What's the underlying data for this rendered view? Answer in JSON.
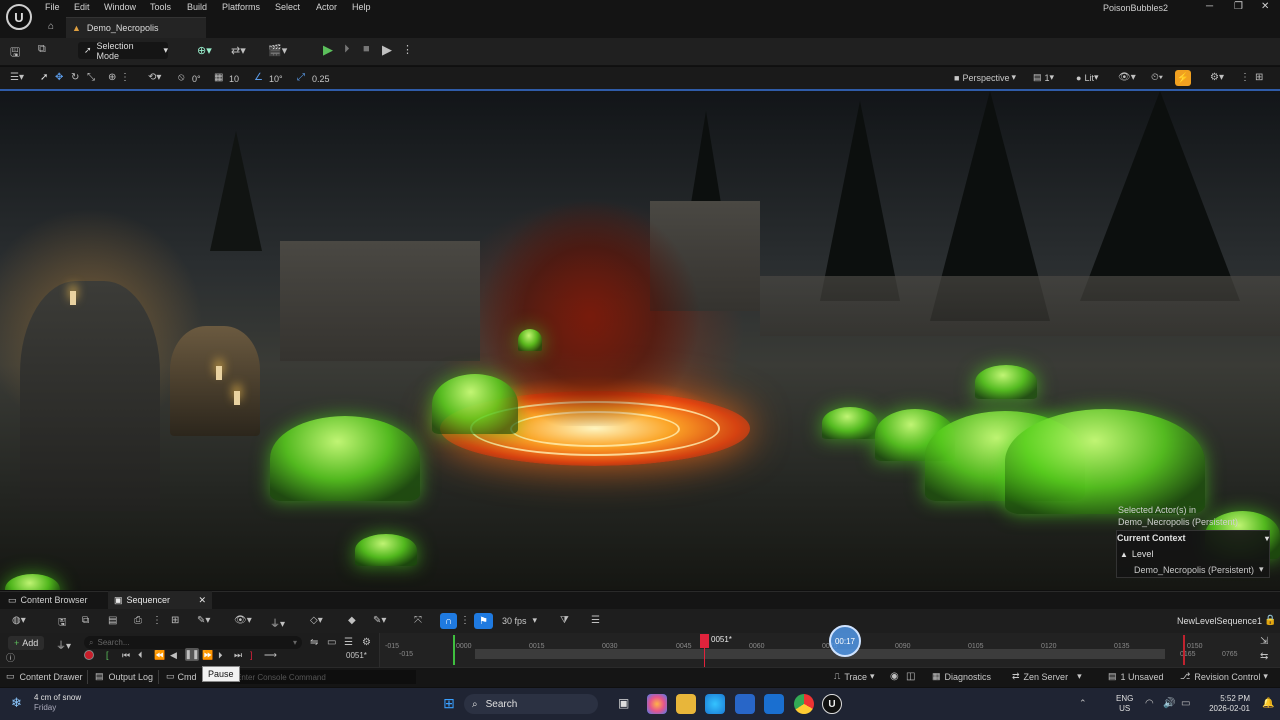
{
  "menu": {
    "items": [
      "File",
      "Edit",
      "Window",
      "Tools",
      "Build",
      "Platforms",
      "Select",
      "Actor",
      "Help"
    ],
    "project_name": "PoisonBubbles2"
  },
  "level_tab": {
    "label": "Demo_Necropolis"
  },
  "toolbar": {
    "selection_mode": "Selection Mode"
  },
  "viewport_toolbar": {
    "rotation_value": "0°",
    "grid_value": "10",
    "angle_value": "10°",
    "scale_value": "0.25",
    "view_mode": "Perspective",
    "camera_speed": "1",
    "lit_mode": "Lit"
  },
  "actor_overlay": {
    "selected_line1": "Selected Actor(s) in",
    "selected_line2": "Demo_Necropolis (Persistent)",
    "current_context": "Current Context",
    "level_label": "Level",
    "level_value": "Demo_Necropolis (Persistent)"
  },
  "panels": {
    "content_browser": "Content Browser",
    "sequencer": "Sequencer"
  },
  "sequencer": {
    "fps": "30 fps",
    "sequence_name": "NewLevelSequence1",
    "add_label": "Add",
    "search_placeholder": "Search...",
    "current_frame": "0051*",
    "playhead_frame": "0051*",
    "playhead_time": "00:17",
    "tooltip": "Pause",
    "ticks": [
      "-015",
      "-015",
      "0000",
      "0015",
      "0030",
      "0045",
      "0060",
      "0075",
      "0090",
      "0105",
      "0120",
      "0135",
      "0150",
      "0165",
      "0765"
    ]
  },
  "status": {
    "content_drawer": "Content Drawer",
    "output_log": "Output Log",
    "cmd_label": "Cmd",
    "console_placeholder": "Enter Console Command",
    "trace": "Trace",
    "diagnostics": "Diagnostics",
    "zen_server": "Zen Server",
    "unsaved": "1 Unsaved",
    "revision_control": "Revision Control"
  },
  "taskbar": {
    "weather_line1": "4 cm of snow",
    "weather_line2": "Friday",
    "search_label": "Search",
    "lang_line1": "ENG",
    "lang_line2": "US",
    "time": "5:52 PM",
    "date": "2026-02-01"
  },
  "colors": {
    "accent_blue": "#2f5ca8",
    "play_green": "#4caf50",
    "playhead_red": "#e0233c",
    "snap_blue": "#1f7ae0",
    "highlight_orange": "#f0a020"
  }
}
